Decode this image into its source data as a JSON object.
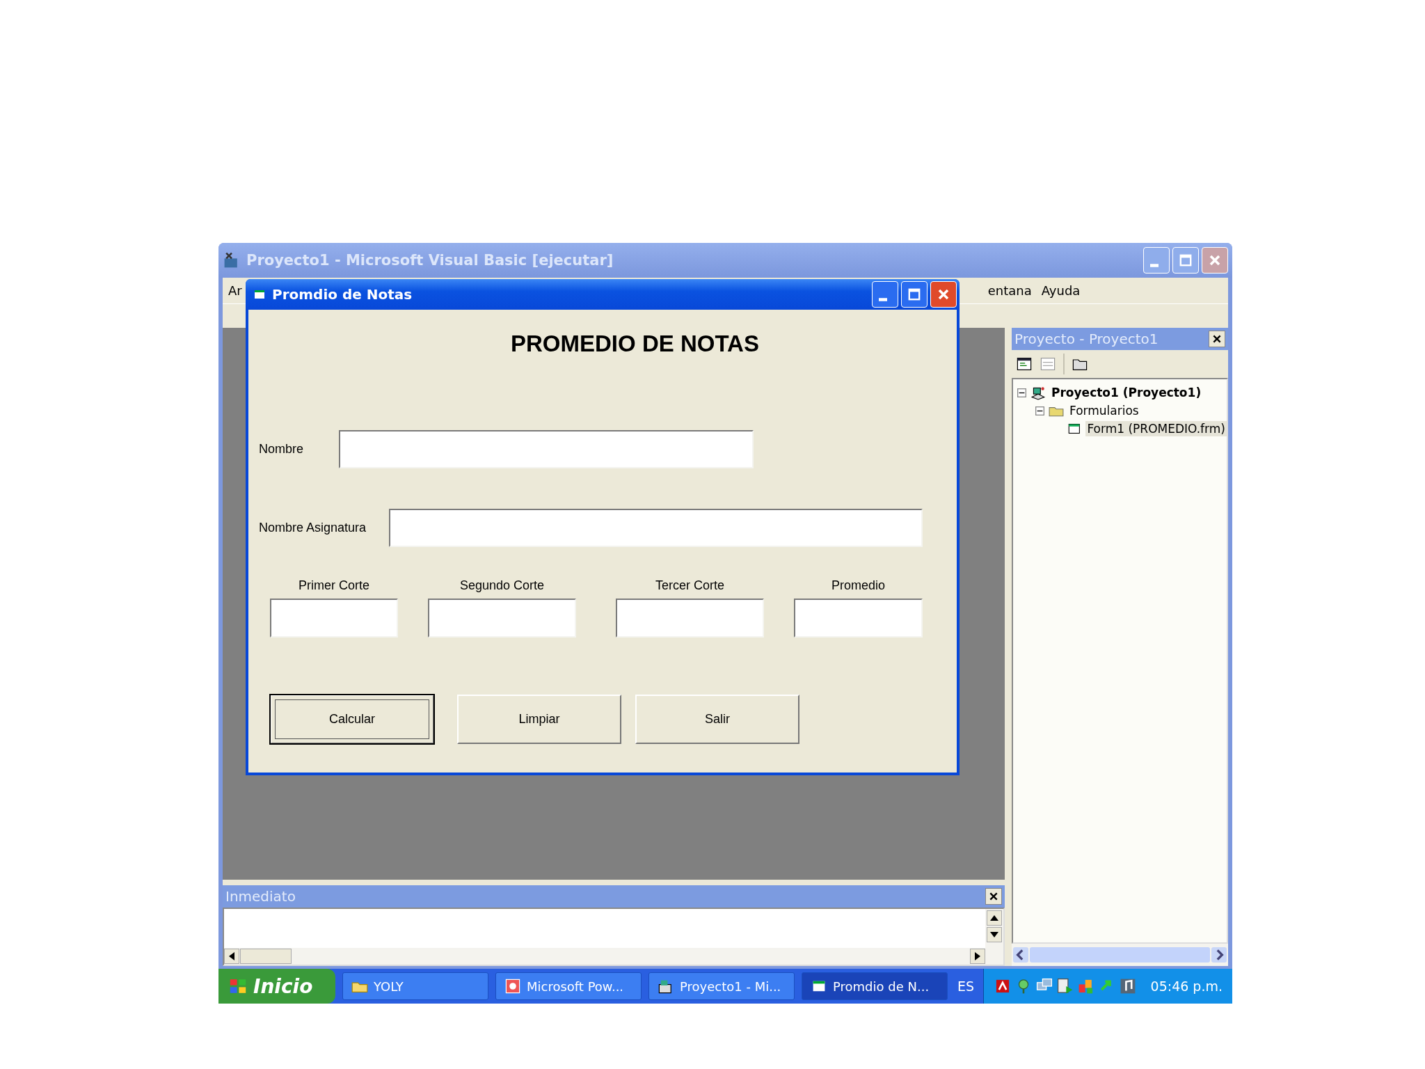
{
  "ide_window": {
    "title": "Proyecto1 - Microsoft Visual Basic [ejecutar]",
    "menu": [
      "Ar",
      "entana",
      "Ayuda"
    ]
  },
  "dialog": {
    "title": "Promdio de Notas",
    "heading": "PROMEDIO DE NOTAS",
    "fields": [
      {
        "label": "Nombre"
      },
      {
        "label": "Nombre Asignatura"
      }
    ],
    "grade_fields": [
      {
        "label": "Primer Corte"
      },
      {
        "label": "Segundo Corte"
      },
      {
        "label": "Tercer Corte"
      },
      {
        "label": "Promedio"
      }
    ],
    "buttons": [
      {
        "label": "Calcular",
        "focused": true
      },
      {
        "label": "Limpiar",
        "focused": false
      },
      {
        "label": "Salir",
        "focused": false
      }
    ]
  },
  "project_panel": {
    "title": "Proyecto - Proyecto1",
    "tree": [
      {
        "label": "Proyecto1 (Proyecto1)",
        "kind": "project",
        "expanded": true,
        "selected": false,
        "children": [
          {
            "label": "Formularios",
            "kind": "folder",
            "expanded": true,
            "selected": false,
            "children": [
              {
                "label": "Form1 (PROMEDIO.frm)",
                "kind": "form",
                "selected": true
              }
            ]
          }
        ]
      }
    ]
  },
  "immediate_panel": {
    "title": "Inmediato"
  },
  "taskbar": {
    "start": "Inicio",
    "tasks": [
      {
        "label": "YOLY",
        "kind": "folder",
        "selected": false
      },
      {
        "label": "Microsoft Pow...",
        "kind": "powerpoint",
        "selected": false
      },
      {
        "label": "Proyecto1 - Mi...",
        "kind": "vb",
        "selected": false
      },
      {
        "label": "Promdio de N...",
        "kind": "form",
        "selected": true
      }
    ],
    "language": "ES",
    "clock": "05:46 p.m."
  }
}
